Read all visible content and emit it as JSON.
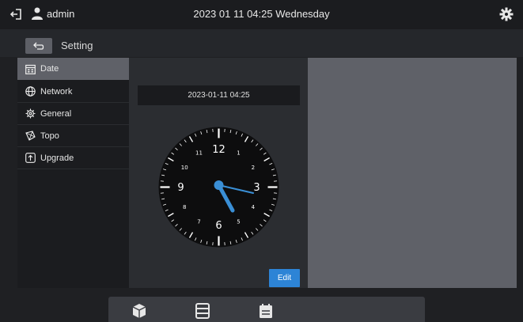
{
  "header": {
    "username": "admin",
    "datetime": "2023 01 11 04:25 Wednesday"
  },
  "subbar": {
    "title": "Setting"
  },
  "sidebar": {
    "items": [
      {
        "label": "Date",
        "icon": "calendar-icon",
        "active": true
      },
      {
        "label": "Network",
        "icon": "globe-icon",
        "active": false
      },
      {
        "label": "General",
        "icon": "gear-icon",
        "active": false
      },
      {
        "label": "Topo",
        "icon": "topo-icon",
        "active": false
      },
      {
        "label": "Upgrade",
        "icon": "upgrade-icon",
        "active": false
      }
    ]
  },
  "date_panel": {
    "current": "2023-01-11 04:25",
    "clock_numbers": [
      "12",
      "1",
      "2",
      "3",
      "4",
      "5",
      "6",
      "7",
      "8",
      "9",
      "10",
      "11"
    ],
    "edit_label": "Edit"
  },
  "dock": {
    "items": [
      "cube-icon",
      "server-icon",
      "calendar-icon"
    ]
  },
  "colors": {
    "accent": "#2d84d6",
    "active_item": "#5f6168",
    "clock_hands": "#3a8fd6"
  }
}
